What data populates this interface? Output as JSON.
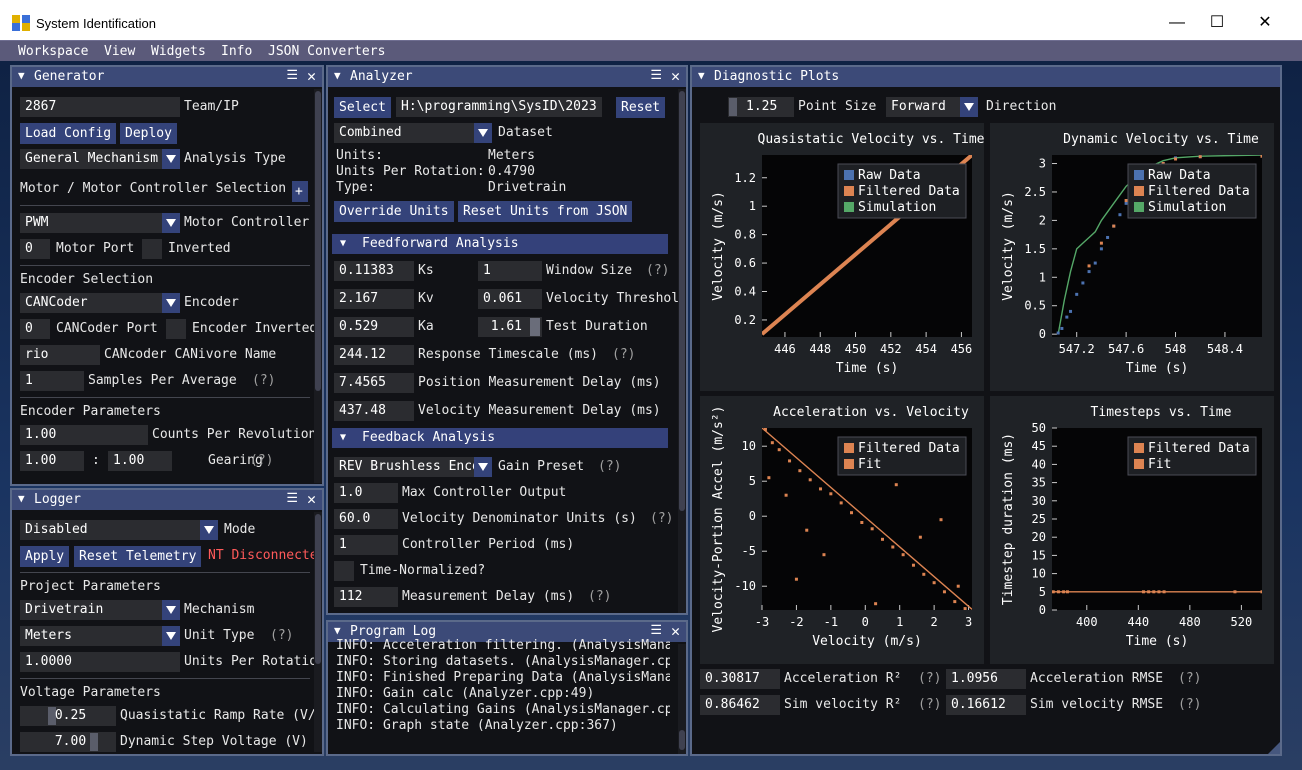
{
  "app": {
    "title": "System Identification"
  },
  "window_controls": {
    "minimize": "—",
    "maximize": "☐",
    "close": "✕"
  },
  "menu": [
    "Workspace",
    "View",
    "Widgets",
    "Info",
    "JSON Converters"
  ],
  "generator": {
    "title": "Generator",
    "team": "2867",
    "team_label": "Team/IP",
    "load_config": "Load Config",
    "deploy": "Deploy",
    "analysis_type": "General Mechanism",
    "analysis_type_label": "Analysis Type",
    "motor_section": "Motor / Motor Controller Selection",
    "add": "+",
    "motor_controller": "PWM",
    "motor_controller_label": "Motor Controller",
    "motor_port": "0",
    "motor_port_label": "Motor Port",
    "inverted_label": "Inverted",
    "encoder_section": "Encoder Selection",
    "encoder": "CANCoder",
    "encoder_label": "Encoder",
    "cancoder_port": "0",
    "cancoder_port_label": "CANCoder Port",
    "encoder_inverted_label": "Encoder Inverted",
    "canivore": "rio",
    "canivore_label": "CANcoder CANivore Name",
    "samples": "1",
    "samples_label": "Samples Per Average",
    "help": "(?)",
    "encoder_params_section": "Encoder Parameters",
    "counts": "1.00",
    "counts_label": "Counts Per Revolution",
    "gear_a": "1.00",
    "gear_sep": ":",
    "gear_b": "1.00",
    "gearing_label": "Gearing"
  },
  "logger": {
    "title": "Logger",
    "mode": "Disabled",
    "mode_label": "Mode",
    "apply": "Apply",
    "reset_telemetry": "Reset Telemetry",
    "nt_status": "NT Disconnected",
    "project_section": "Project Parameters",
    "mechanism": "Drivetrain",
    "mechanism_label": "Mechanism",
    "unit_type": "Meters",
    "unit_type_label": "Unit Type",
    "help": "(?)",
    "units_per_rot": "1.0000",
    "units_per_rot_label": "Units Per Rotation",
    "voltage_section": "Voltage Parameters",
    "ramp_rate": "0.25",
    "ramp_rate_label": "Quasistatic Ramp Rate (V/s)",
    "step_voltage": "7.00",
    "step_voltage_label": "Dynamic Step Voltage (V)"
  },
  "analyzer": {
    "title": "Analyzer",
    "select": "Select",
    "path": "H:\\programming\\SysID\\2023",
    "reset": "Reset",
    "dataset": "Combined",
    "dataset_label": "Dataset",
    "units_key": "Units:",
    "units_val": "Meters",
    "upr_key": "Units Per Rotation:",
    "upr_val": "0.4790",
    "type_key": "Type:",
    "type_val": "Drivetrain",
    "override_units": "Override Units",
    "reset_units": "Reset Units from JSON",
    "ff_section": "Feedforward Analysis",
    "ks": "0.11383",
    "ks_label": "Ks",
    "window_size": "1",
    "window_size_label": "Window Size",
    "help": "(?)",
    "kv": "2.167",
    "kv_label": "Kv",
    "vel_threshold": "0.061",
    "vel_threshold_label": "Velocity Threshold",
    "ka": "0.529",
    "ka_label": "Ka",
    "test_duration": "1.61",
    "test_duration_label": "Test Duration",
    "response": "244.12",
    "response_label": "Response Timescale (ms)",
    "pos_delay": "7.4565",
    "pos_delay_label": "Position Measurement Delay (ms)",
    "vel_delay": "437.48",
    "vel_delay_label": "Velocity Measurement Delay (ms)",
    "fb_section": "Feedback Analysis",
    "gain_preset": "REV Brushless Encoder Port",
    "gain_preset_label": "Gain Preset",
    "max_output": "1.0",
    "max_output_label": "Max Controller Output",
    "vel_denom": "60.0",
    "vel_denom_label": "Velocity Denominator Units (s)",
    "ctrl_period": "1",
    "ctrl_period_label": "Controller Period (ms)",
    "time_norm_label": "Time-Normalized?",
    "meas_delay": "112",
    "meas_delay_label": "Measurement Delay (ms)"
  },
  "program_log": {
    "title": "Program Log",
    "lines": [
      "INFO: Acceleration filtering. (AnalysisManager.cpp:...)",
      "INFO: Storing datasets. (AnalysisManager.cpp:...)",
      "INFO: Finished Preparing Data (AnalysisManager.cpp:...)",
      "INFO: Gain calc (Analyzer.cpp:49)",
      "INFO: Calculating Gains (AnalysisManager.cpp:...)",
      "INFO: Graph state (Analyzer.cpp:367)"
    ]
  },
  "diagnostic": {
    "title": "Diagnostic Plots",
    "point_size": "1.25",
    "point_size_label": "Point Size",
    "direction": "Forward",
    "direction_label": "Direction",
    "accel_r2": "0.30817",
    "accel_r2_label": "Acceleration R²",
    "accel_rmse": "1.0956",
    "accel_rmse_label": "Acceleration RMSE",
    "sim_r2": "0.86462",
    "sim_r2_label": "Sim velocity R²",
    "sim_rmse": "0.16612",
    "sim_rmse_label": "Sim velocity RMSE",
    "help": "(?)"
  },
  "colors": {
    "raw": "#4c72b0",
    "filtered": "#dd8452",
    "sim": "#55a868",
    "fit": "#dd8452"
  },
  "chart_data": [
    {
      "type": "line",
      "title": "Quasistatic Velocity vs. Time",
      "xlabel": "Time (s)",
      "ylabel": "Velocity (m/s)",
      "xlim": [
        444.7,
        456.6
      ],
      "ylim": [
        0.08,
        1.36
      ],
      "xticks": [
        446,
        448,
        450,
        452,
        454,
        456
      ],
      "yticks": [
        0.2,
        0.4,
        0.6,
        0.8,
        1,
        1.2
      ],
      "legend": [
        "Raw Data",
        "Filtered Data",
        "Simulation"
      ],
      "legend_position": "top-right",
      "series": [
        {
          "name": "Filtered Data",
          "x": [
            444.7,
            456.6
          ],
          "y": [
            0.1,
            1.36
          ]
        }
      ]
    },
    {
      "type": "scatter",
      "title": "Dynamic Velocity vs. Time",
      "xlabel": "Time (s)",
      "ylabel": "Velocity (m/s)",
      "xlim": [
        547.0,
        548.7
      ],
      "ylim": [
        -0.05,
        3.15
      ],
      "xticks": [
        547.2,
        547.6,
        548,
        548.4
      ],
      "xtick_labels": [
        "547.2",
        "547.6",
        "548",
        "548.4"
      ],
      "yticks": [
        0,
        0.5,
        1,
        1.5,
        2,
        2.5,
        3
      ],
      "legend": [
        "Raw Data",
        "Filtered Data",
        "Simulation"
      ],
      "legend_position": "top-right",
      "series": [
        {
          "name": "Simulation",
          "x": [
            547.05,
            547.1,
            547.15,
            547.2,
            547.25,
            547.3,
            547.35,
            547.4,
            547.5,
            547.6,
            547.7,
            547.8,
            547.9,
            548.0,
            548.2,
            548.7
          ],
          "y": [
            0,
            0.6,
            1.1,
            1.5,
            1.6,
            1.7,
            1.8,
            2.0,
            2.3,
            2.6,
            2.8,
            2.95,
            3.05,
            3.1,
            3.13,
            3.15
          ]
        },
        {
          "name": "Raw Data",
          "x": [
            547.05,
            547.08,
            547.12,
            547.15,
            547.2,
            547.25,
            547.3,
            547.35,
            547.4,
            547.45,
            547.5,
            547.55,
            547.6,
            547.7,
            547.8,
            547.9,
            548.0,
            548.2,
            548.7
          ],
          "y": [
            0.02,
            0.1,
            0.3,
            0.4,
            0.7,
            0.9,
            1.1,
            1.25,
            1.5,
            1.7,
            1.9,
            2.1,
            2.3,
            2.6,
            2.85,
            3.0,
            3.1,
            3.12,
            3.13
          ]
        },
        {
          "name": "Filtered Data",
          "x": [
            547.3,
            547.4,
            547.5,
            547.6,
            547.7,
            547.8,
            547.9,
            548.0,
            548.2,
            548.7
          ],
          "y": [
            1.2,
            1.6,
            1.9,
            2.35,
            2.65,
            2.85,
            3.0,
            3.08,
            3.12,
            3.13
          ]
        }
      ]
    },
    {
      "type": "scatter",
      "title": "Acceleration vs. Velocity",
      "xlabel": "Velocity (m/s)",
      "ylabel": "Velocity-Portion Accel (m/s²)",
      "xlim": [
        -3.0,
        3.1
      ],
      "ylim": [
        -13.4,
        12.6
      ],
      "xticks": [
        -3,
        -2,
        -1,
        0,
        1,
        2,
        3
      ],
      "yticks": [
        -10,
        -5,
        0,
        5,
        10
      ],
      "legend": [
        "Filtered Data",
        "Fit"
      ],
      "legend_position": "top-right",
      "series": [
        {
          "name": "Filtered Data",
          "x": [
            -2.9,
            -2.7,
            -2.5,
            -2.2,
            -1.9,
            -1.6,
            -1.3,
            -1.0,
            -0.7,
            -0.4,
            -0.1,
            0.2,
            0.5,
            0.8,
            1.1,
            1.4,
            1.7,
            2.0,
            2.3,
            2.6,
            2.9,
            -2.8,
            -2.3,
            -1.7,
            -1.2,
            0.9,
            1.6,
            2.2,
            2.7,
            -2.0,
            0.3
          ],
          "y": [
            12.4,
            10.5,
            9.5,
            7.9,
            6.5,
            5.2,
            3.9,
            3.2,
            1.9,
            0.5,
            -0.9,
            -1.8,
            -3.3,
            -4.4,
            -5.5,
            -7.0,
            -8.3,
            -9.5,
            -10.8,
            -12.2,
            -13.2,
            5.5,
            3.0,
            -2.0,
            -5.5,
            4.5,
            -3.0,
            -0.5,
            -10.0,
            -9.0,
            -12.5
          ]
        },
        {
          "name": "Fit",
          "x": [
            -3.0,
            3.1
          ],
          "y": [
            12.6,
            -13.3
          ]
        }
      ]
    },
    {
      "type": "scatter",
      "title": "Timesteps vs. Time",
      "xlabel": "Time (s)",
      "ylabel": "Timestep duration (ms)",
      "xlim": [
        373,
        536
      ],
      "ylim": [
        0,
        50
      ],
      "xticks": [
        400,
        440,
        480,
        520
      ],
      "yticks": [
        0,
        5,
        10,
        15,
        20,
        25,
        30,
        35,
        40,
        45,
        50
      ],
      "legend": [
        "Filtered Data",
        "Fit"
      ],
      "legend_position": "top-right",
      "series": [
        {
          "name": "Filtered Data",
          "x": [
            374,
            378,
            382,
            385,
            444,
            448,
            452,
            456,
            460,
            515,
            536
          ],
          "y": [
            5,
            5,
            5,
            5,
            5,
            5,
            5,
            5,
            5,
            5,
            5
          ]
        },
        {
          "name": "Fit",
          "x": [
            373,
            536
          ],
          "y": [
            5,
            5
          ]
        }
      ]
    }
  ]
}
